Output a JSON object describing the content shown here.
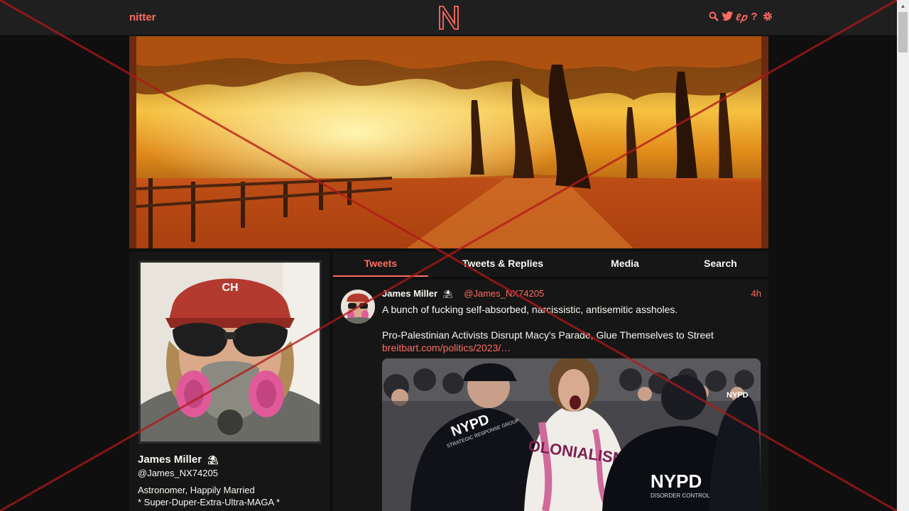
{
  "navbar": {
    "brand": "nitter",
    "logo_letter": "N",
    "icons": [
      "search-icon",
      "twitter-bird-icon",
      "rss-icon",
      "help-icon",
      "settings-gear-icon"
    ]
  },
  "colors": {
    "accent": "#ff6c60",
    "background": "#0f0f0f",
    "panel": "#161616",
    "navbar": "#1f1f1f",
    "overlay_x": "#b01818"
  },
  "profile": {
    "fullname": "James Miller",
    "badge": "⛱",
    "username": "@James_NX74205",
    "bio_line1": "Astronomer, Happily Married",
    "bio_line2": "* Super-Duper-Extra-Ultra-MAGA *"
  },
  "tabs": [
    {
      "label": "Tweets",
      "active": true
    },
    {
      "label": "Tweets & Replies",
      "active": false
    },
    {
      "label": "Media",
      "active": false
    },
    {
      "label": "Search",
      "active": false
    }
  ],
  "tweet": {
    "fullname": "James Miller",
    "badge": "⛱",
    "username": "@James_NX74205",
    "date": "4h",
    "text": "A bunch of fucking self-absorbed, narcissistic, antisemitic assholes.",
    "quote_title": "Pro-Palestinian Activists Disrupt Macy's Parade, Glue Themselves to Street",
    "link": "breitbart.com/politics/2023/…",
    "media_texts": {
      "badge_left": "NYPD",
      "badge_left_sub": "STRATEGIC RESPONSE GROUP",
      "shirt": "OLONIALISM",
      "badge_right": "NYPD",
      "badge_right_sub": "DISORDER CONTROL UNIT",
      "badge_far_right": "NYPD"
    }
  }
}
